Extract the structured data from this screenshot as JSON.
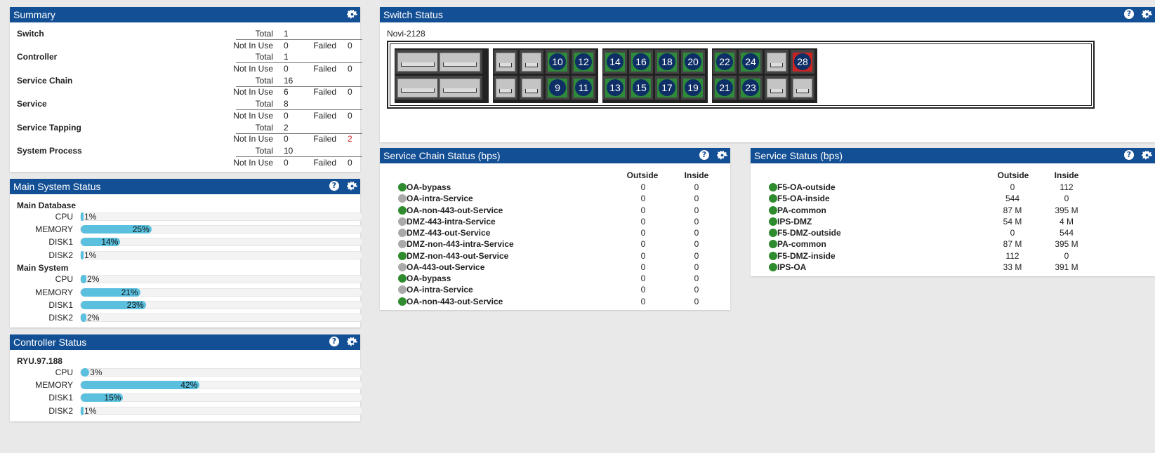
{
  "summary": {
    "title": "Summary",
    "rows": [
      {
        "name": "Switch",
        "total": "1",
        "not_in_use": "0",
        "failed": "0",
        "failed_color": "#222"
      },
      {
        "name": "Controller",
        "total": "1",
        "not_in_use": "0",
        "failed": "0",
        "failed_color": "#222"
      },
      {
        "name": "Service Chain",
        "total": "16",
        "not_in_use": "6",
        "failed": "0",
        "failed_color": "#222"
      },
      {
        "name": "Service",
        "total": "8",
        "not_in_use": "0",
        "failed": "0",
        "failed_color": "#222"
      },
      {
        "name": "Service Tapping",
        "total": "2",
        "not_in_use": "0",
        "failed": "2",
        "failed_color": "#cc2222"
      },
      {
        "name": "System Process",
        "total": "10",
        "not_in_use": "0",
        "failed": "0",
        "failed_color": "#222"
      }
    ],
    "labels": {
      "total": "Total",
      "not_in_use": "Not In Use",
      "failed": "Failed"
    }
  },
  "main_system": {
    "title": "Main System Status",
    "groups": [
      {
        "name": "Main Database",
        "items": [
          {
            "label": "CPU",
            "pct": 1,
            "text": "1%"
          },
          {
            "label": "MEMORY",
            "pct": 25,
            "text": "25%"
          },
          {
            "label": "DISK1",
            "pct": 14,
            "text": "14%"
          },
          {
            "label": "DISK2",
            "pct": 1,
            "text": "1%"
          }
        ]
      },
      {
        "name": "Main System",
        "items": [
          {
            "label": "CPU",
            "pct": 2,
            "text": "2%"
          },
          {
            "label": "MEMORY",
            "pct": 21,
            "text": "21%"
          },
          {
            "label": "DISK1",
            "pct": 23,
            "text": "23%"
          },
          {
            "label": "DISK2",
            "pct": 2,
            "text": "2%"
          }
        ]
      }
    ]
  },
  "controller": {
    "title": "Controller Status",
    "groups": [
      {
        "name": "RYU.97.188",
        "items": [
          {
            "label": "CPU",
            "pct": 3,
            "text": "3%"
          },
          {
            "label": "MEMORY",
            "pct": 42,
            "text": "42%"
          },
          {
            "label": "DISK1",
            "pct": 15,
            "text": "15%"
          },
          {
            "label": "DISK2",
            "pct": 1,
            "text": "1%"
          }
        ]
      }
    ]
  },
  "switch": {
    "title": "Switch Status",
    "name": "Novi-2128",
    "ports_top": [
      {
        "n": "10",
        "status": "up"
      },
      {
        "n": "12",
        "status": "up"
      },
      {
        "n": "14",
        "status": "up"
      },
      {
        "n": "16",
        "status": "up"
      },
      {
        "n": "18",
        "status": "up"
      },
      {
        "n": "20",
        "status": "up"
      },
      {
        "n": "22",
        "status": "up"
      },
      {
        "n": "24",
        "status": "up"
      },
      {
        "n": "28",
        "status": "failed"
      }
    ],
    "ports_bottom": [
      {
        "n": "9",
        "status": "up"
      },
      {
        "n": "11",
        "status": "up"
      },
      {
        "n": "13",
        "status": "up"
      },
      {
        "n": "15",
        "status": "up"
      },
      {
        "n": "17",
        "status": "up"
      },
      {
        "n": "19",
        "status": "up"
      },
      {
        "n": "21",
        "status": "up"
      },
      {
        "n": "23",
        "status": "up"
      }
    ]
  },
  "chain_status": {
    "title": "Service Chain Status (bps)",
    "col_outside": "Outside",
    "col_inside": "Inside",
    "rows": [
      {
        "name": "OA-bypass",
        "state": "green",
        "outside": "0",
        "inside": "0"
      },
      {
        "name": "OA-intra-Service",
        "state": "gray",
        "outside": "0",
        "inside": "0"
      },
      {
        "name": "OA-non-443-out-Service",
        "state": "green",
        "outside": "0",
        "inside": "0"
      },
      {
        "name": "DMZ-443-intra-Service",
        "state": "gray",
        "outside": "0",
        "inside": "0"
      },
      {
        "name": "DMZ-443-out-Service",
        "state": "gray",
        "outside": "0",
        "inside": "0"
      },
      {
        "name": "DMZ-non-443-intra-Service",
        "state": "gray",
        "outside": "0",
        "inside": "0"
      },
      {
        "name": "DMZ-non-443-out-Service",
        "state": "green",
        "outside": "0",
        "inside": "0"
      },
      {
        "name": "OA-443-out-Service",
        "state": "gray",
        "outside": "0",
        "inside": "0"
      },
      {
        "name": "OA-bypass",
        "state": "green",
        "outside": "0",
        "inside": "0"
      },
      {
        "name": "OA-intra-Service",
        "state": "gray",
        "outside": "0",
        "inside": "0"
      },
      {
        "name": "OA-non-443-out-Service",
        "state": "green",
        "outside": "0",
        "inside": "0"
      }
    ]
  },
  "service_status": {
    "title": "Service Status (bps)",
    "col_outside": "Outside",
    "col_inside": "Inside",
    "rows": [
      {
        "name": "F5-OA-outside",
        "state": "green",
        "outside": "0",
        "inside": "112"
      },
      {
        "name": "F5-OA-inside",
        "state": "green",
        "outside": "544",
        "inside": "0"
      },
      {
        "name": "PA-common",
        "state": "green",
        "outside": "87 M",
        "inside": "395 M"
      },
      {
        "name": "IPS-DMZ",
        "state": "green",
        "outside": "54 M",
        "inside": "4 M"
      },
      {
        "name": "F5-DMZ-outside",
        "state": "green",
        "outside": "0",
        "inside": "544"
      },
      {
        "name": "PA-common",
        "state": "green",
        "outside": "87 M",
        "inside": "395 M"
      },
      {
        "name": "F5-DMZ-inside",
        "state": "green",
        "outside": "112",
        "inside": "0"
      },
      {
        "name": "IPS-OA",
        "state": "green",
        "outside": "33 M",
        "inside": "391 M"
      }
    ]
  },
  "colors": {
    "header": "#134f94",
    "green": "#2e8b2e",
    "gray": "#aaaaaa",
    "bar": "#5bc0de",
    "failed": "#cc2222"
  },
  "icons": {
    "help": "?",
    "settings": "gear-icon"
  }
}
